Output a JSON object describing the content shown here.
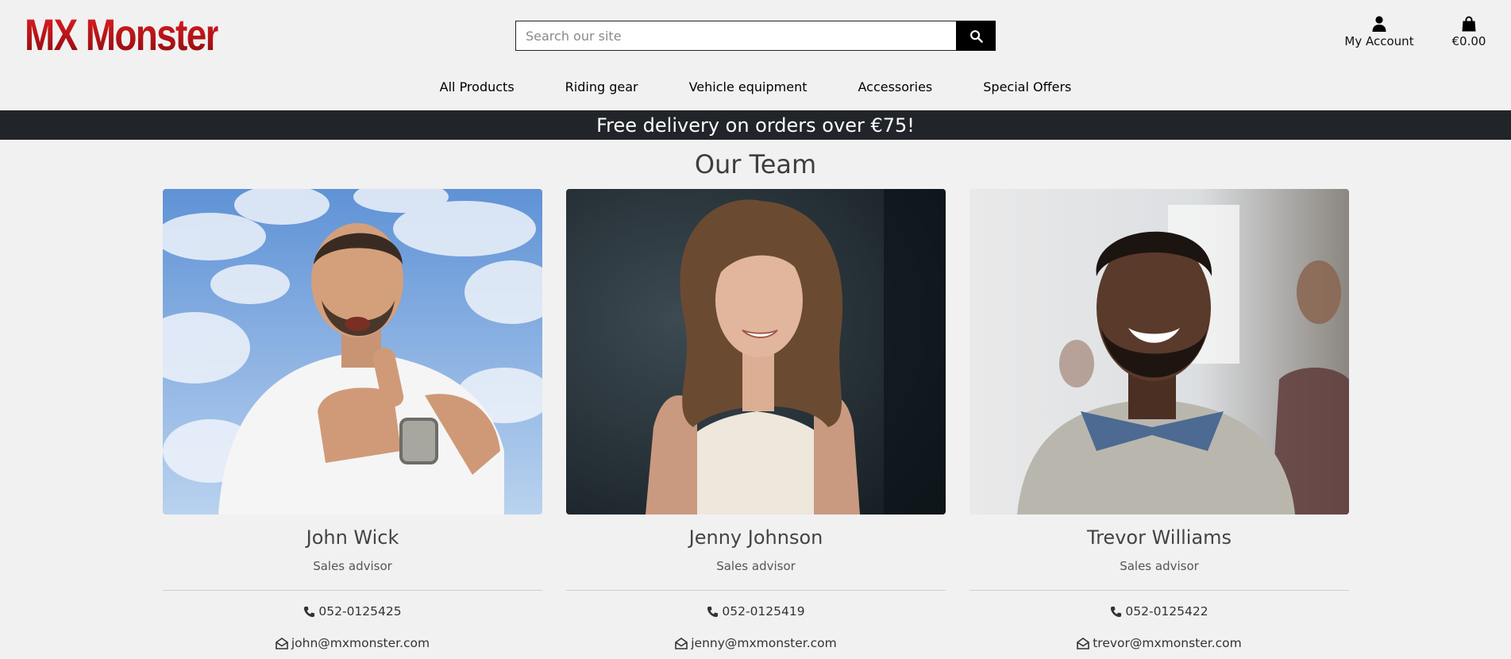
{
  "brand": {
    "logo_text": "MX Monster"
  },
  "search": {
    "placeholder": "Search our site",
    "value": ""
  },
  "header": {
    "account_label": "My Account",
    "cart_total": "€0.00"
  },
  "nav": [
    "All Products",
    "Riding gear",
    "Vehicle equipment",
    "Accessories",
    "Special Offers"
  ],
  "banner": {
    "text": "Free delivery on orders over €75!"
  },
  "page": {
    "title": "Our Team"
  },
  "team": [
    {
      "name": "John Wick",
      "role": "Sales advisor",
      "phone": "052-0125425",
      "email": "john@mxmonster.com"
    },
    {
      "name": "Jenny Johnson",
      "role": "Sales advisor",
      "phone": "052-0125419",
      "email": "jenny@mxmonster.com"
    },
    {
      "name": "Trevor Williams",
      "role": "Sales advisor",
      "phone": "052-0125422",
      "email": "trevor@mxmonster.com"
    }
  ],
  "colors": {
    "logo": "#c4141a",
    "banner_bg": "#212529",
    "page_bg": "#f1f1f1"
  },
  "icons": [
    "search-icon",
    "user-icon",
    "shopping-bag-icon",
    "phone-icon",
    "envelope-open-icon"
  ]
}
